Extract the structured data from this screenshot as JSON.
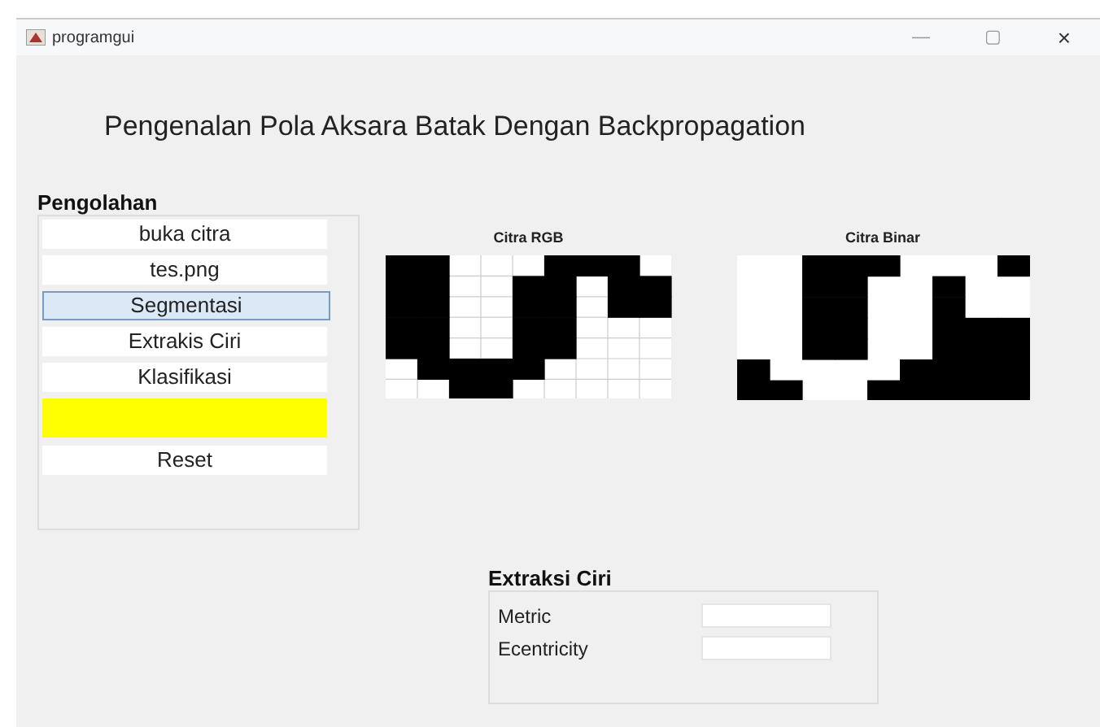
{
  "window": {
    "title": "programgui",
    "controls": [
      "—",
      "▢",
      "×"
    ]
  },
  "heading": "Pengenalan Pola Aksara Batak Dengan Backpropagation",
  "pengolahan": {
    "title": "Pengolahan",
    "items": [
      {
        "kind": "button",
        "label": "buka citra",
        "selected": false
      },
      {
        "kind": "text",
        "label": "tes.png",
        "selected": false
      },
      {
        "kind": "button",
        "label": "Segmentasi",
        "selected": true
      },
      {
        "kind": "button",
        "label": "Extrakis Ciri",
        "selected": false
      },
      {
        "kind": "button",
        "label": "Klasifikasi",
        "selected": false
      },
      {
        "kind": "indicator",
        "color": "#ffff00",
        "selected": false
      },
      {
        "kind": "button",
        "label": "Reset",
        "selected": false
      }
    ]
  },
  "axes": [
    {
      "title": "Citra RGB",
      "kind": "grid"
    },
    {
      "title": "Citra Binar",
      "kind": "binary"
    }
  ],
  "extraksi": {
    "title": "Extraksi Ciri",
    "fields": [
      {
        "label": "Metric"
      },
      {
        "label": "Ecentricity"
      }
    ]
  }
}
